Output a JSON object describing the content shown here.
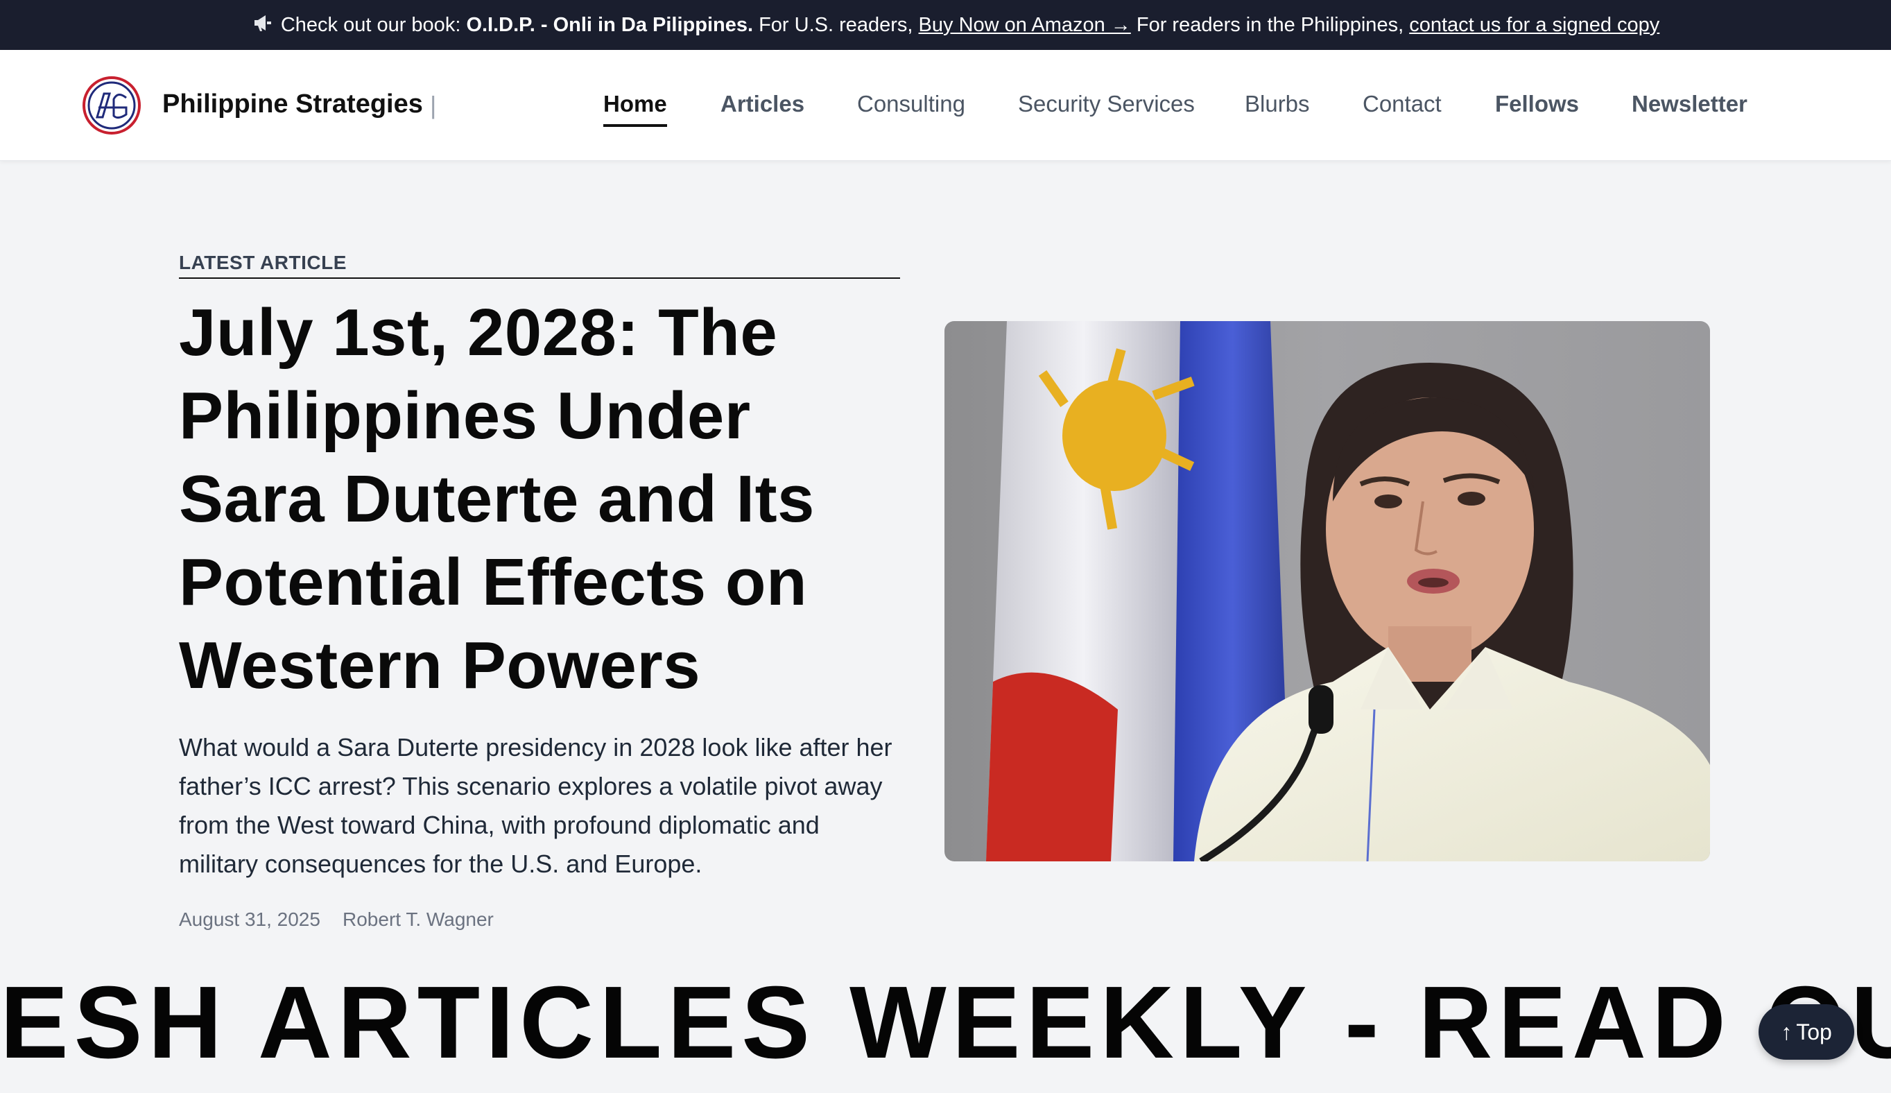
{
  "announcement": {
    "icon": "megaphone-icon",
    "prefix": "Check out our book: ",
    "book_title": "O.I.D.P. - Onli in Da Pilippines.",
    "us_text": " For U.S. readers, ",
    "us_link": "Buy Now on Amazon →",
    "ph_text": " For readers in the Philippines, ",
    "ph_link": "contact us for a signed copy"
  },
  "header": {
    "brand": "Philippine Strategies",
    "separator": "|",
    "logo_colors": {
      "ring_outer": "#c8202f",
      "ring_inner": "#1f2a7a"
    },
    "nav": [
      {
        "label": "Home"
      },
      {
        "label": "Articles"
      },
      {
        "label": "Consulting"
      },
      {
        "label": "Security Services"
      },
      {
        "label": "Blurbs"
      },
      {
        "label": "Contact"
      },
      {
        "label": "Fellows"
      },
      {
        "label": "Newsletter"
      }
    ]
  },
  "article": {
    "eyebrow": "LATEST ARTICLE",
    "title": "July 1st, 2028: The Philippines Under Sara Duterte and Its Potential Effects on Western Powers",
    "excerpt": "What would a Sara Duterte presidency in 2028 look like after her father’s ICC arrest? This scenario explores a volatile pivot away from the West toward China, with profound diplomatic and military consequences for the U.S. and Europe.",
    "date": "August 31, 2025",
    "author": "Robert T. Wagner"
  },
  "ticker": {
    "text": "ESH ARTICLES WEEKLY - READ OUR"
  },
  "back_to_top": {
    "label": "Top",
    "icon": "arrow-up-icon"
  },
  "colors": {
    "topbar_bg": "#1a1e2e",
    "page_bg": "#f3f4f6",
    "button_bg": "#1c2436"
  }
}
